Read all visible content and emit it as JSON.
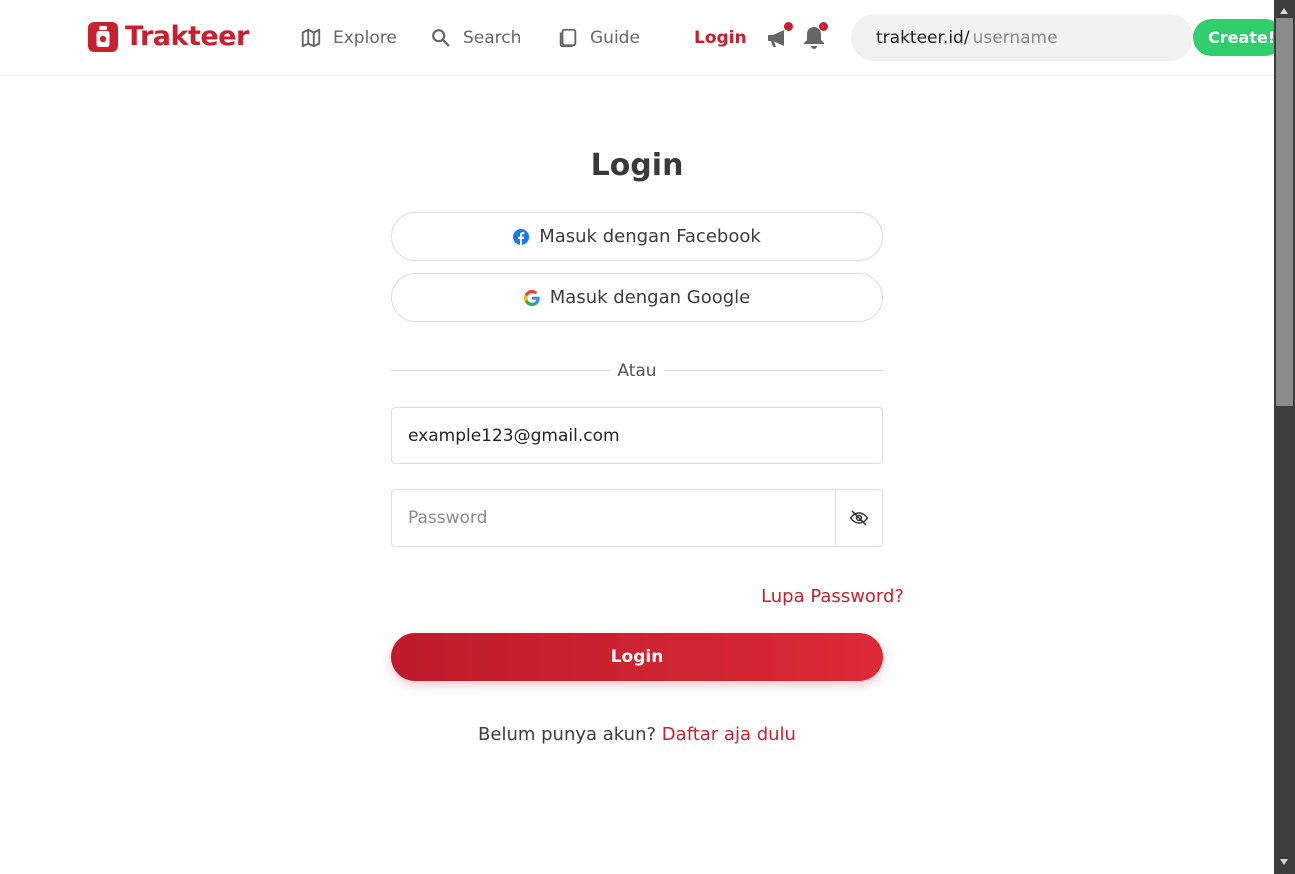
{
  "brand": {
    "name": "Trakteer",
    "color": "#c8202f"
  },
  "nav": {
    "explore": {
      "label": "Explore",
      "icon": "map-icon"
    },
    "search": {
      "label": "Search",
      "icon": "search-icon"
    },
    "guide": {
      "label": "Guide",
      "icon": "book-icon"
    },
    "login": "Login"
  },
  "header_icons": [
    "megaphone-icon",
    "bell-icon"
  ],
  "url_box": {
    "prefix": "trakteer.id/",
    "placeholder": "username"
  },
  "create_button": "Create!",
  "login_form": {
    "title": "Login",
    "facebook_button": "Masuk dengan Facebook",
    "google_button": "Masuk dengan Google",
    "divider": "Atau",
    "email_value": "example123@gmail.com",
    "password_placeholder": "Password",
    "forgot_password": "Lupa Password?",
    "submit": "Login",
    "signup_prompt": "Belum punya akun?",
    "signup_link": "Daftar aja dulu"
  },
  "colors": {
    "accent": "#c8202f",
    "create": "#2fcf6e",
    "facebook": "#1877f2"
  }
}
